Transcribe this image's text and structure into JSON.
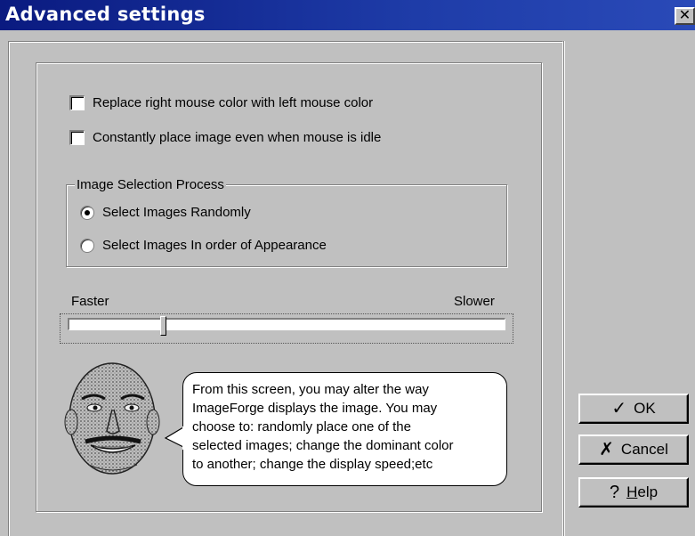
{
  "window": {
    "title": "Advanced settings",
    "close_label": "×"
  },
  "options": {
    "replace_color": {
      "label": "Replace right mouse color with left mouse color",
      "checked": false
    },
    "constant_place": {
      "label": "Constantly place image even when mouse is idle",
      "checked": false
    }
  },
  "selection_group": {
    "title": "Image Selection Process",
    "options": [
      {
        "label": "Select Images Randomly",
        "selected": true
      },
      {
        "label": "Select Images In order of Appearance",
        "selected": false
      }
    ]
  },
  "speed_slider": {
    "min_label": "Faster",
    "max_label": "Slower",
    "value": 0.21
  },
  "help_bubble": {
    "lines": [
      "From this screen, you may alter the way",
      "ImageForge displays the image. You may",
      "choose to: randomly place one of the",
      "selected images; change the dominant color",
      "to another; change the display speed;etc"
    ]
  },
  "buttons": {
    "ok": {
      "label": "OK",
      "icon": "checkmark-icon"
    },
    "cancel": {
      "label": "Cancel",
      "icon": "x-cross-icon"
    },
    "help": {
      "prefix": "",
      "accel": "H",
      "rest": "elp",
      "icon": "question-mark-icon"
    }
  }
}
